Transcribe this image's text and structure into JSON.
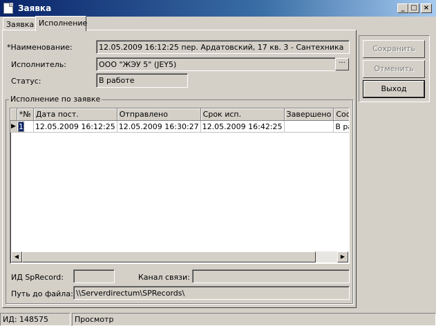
{
  "window": {
    "title": "Заявка",
    "minimize": "_",
    "maximize": "□",
    "close": "×"
  },
  "tabs": [
    {
      "label": "Заявка"
    },
    {
      "label": "Исполнение"
    }
  ],
  "form": {
    "name_label": "*Наименование:",
    "name_value": "12.05.2009 16:12:25 пер. Ардатовский, 17 кв. 3 - Сантехника",
    "executor_label": "Исполнитель:",
    "executor_value": "ООО \"ЖЭУ 5\" (JEY5)",
    "executor_button": "···",
    "status_label": "Статус:",
    "status_value": "В работе"
  },
  "execution_group": {
    "title": "Исполнение по заявке",
    "columns": [
      "*№",
      "Дата пост.",
      "Отправлено",
      "Срок исп.",
      "Завершено",
      "Состояни"
    ],
    "rows": [
      {
        "marker": "▶",
        "num": "1",
        "date_received": "12.05.2009 16:12:25",
        "sent": "12.05.2009 16:30:27",
        "deadline": "12.05.2009 16:42:25",
        "completed": "",
        "state": "В работе"
      }
    ],
    "spr_id_label": "ИД SpRecord:",
    "spr_id_value": "",
    "channel_label": "Канал связи:",
    "channel_value": "",
    "path_label": "Путь до файла:",
    "path_value": "\\\\Serverdirectum\\SPRecords\\"
  },
  "buttons": {
    "save": "Сохранить",
    "cancel": "Отменить",
    "exit": "Выход"
  },
  "statusbar": {
    "id": "ИД: 148575",
    "mode": "Просмотр"
  }
}
